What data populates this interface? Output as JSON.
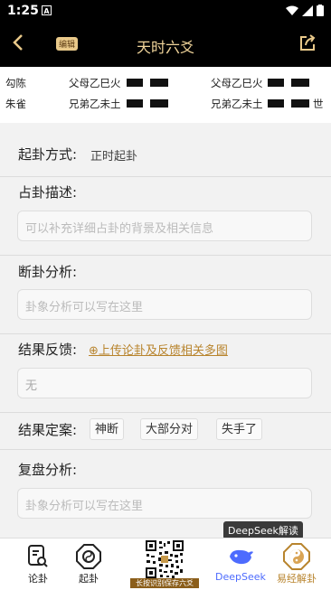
{
  "status": {
    "time": "1:25",
    "notif": "A"
  },
  "header": {
    "title": "天时六爻",
    "edit_badge": "编辑"
  },
  "yao_rows": [
    {
      "left": "勾陈",
      "mid": "父母乙巳火",
      "right": "父母乙巳火",
      "tail": ""
    },
    {
      "left": "朱雀",
      "mid": "兄弟乙未土",
      "right": "兄弟乙未土",
      "tail": "世"
    }
  ],
  "method": {
    "label": "起卦方式:",
    "value": "正时起卦"
  },
  "description": {
    "label": "占卦描述:",
    "placeholder": "可以补充详细占卦的背景及相关信息"
  },
  "analysis": {
    "label": "断卦分析:",
    "placeholder": "卦象分析可以写在这里"
  },
  "feedback": {
    "label": "结果反馈:",
    "upload": "⊕上传论卦及反馈相关多图",
    "value": "无"
  },
  "verdict": {
    "label": "结果定案:",
    "options": [
      "神断",
      "大部分对",
      "失手了"
    ]
  },
  "review": {
    "label": "复盘分析:",
    "placeholder": "卦象分析可以写在这里"
  },
  "deepseek_tip": "DeepSeek解读",
  "tabs": {
    "discuss": "论卦",
    "cast": "起卦",
    "qr_caption": "长按识别保存六爻",
    "deepseek": "DeepSeek",
    "yijing": "易经解卦"
  },
  "colors": {
    "accent": "#e9c98a",
    "link": "#b8842d",
    "deepseek_blue": "#4d6bfe"
  }
}
